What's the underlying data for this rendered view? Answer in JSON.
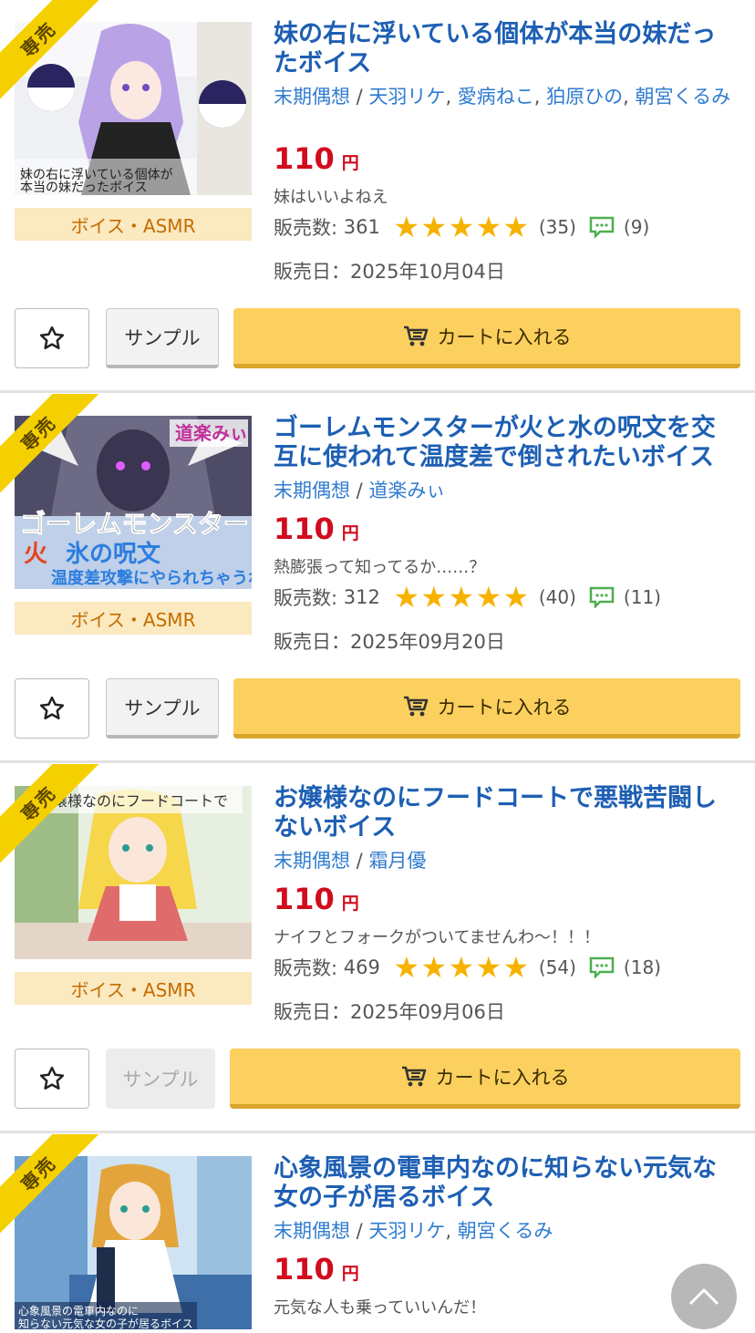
{
  "badge_label": "専売",
  "genre_label": "ボイス・ASMR",
  "currency": "円",
  "sales_label": "販売数:",
  "date_label": "販売日：",
  "sample_label": "サンプル",
  "cart_label": "カートに入れる",
  "colors": {
    "title": "#1d5fb3",
    "price": "#d20b1e",
    "star": "#f7b200",
    "cart": "#fcd05f",
    "badge": "#f5d000"
  },
  "products": [
    {
      "title": "妹の右に浮いている個体が本当の妹だったボイス",
      "circle": "末期偶想",
      "cast": [
        "天羽リケ",
        "愛病ねこ",
        "狛原ひの",
        "朝宮くるみ"
      ],
      "price": "110",
      "description": "妹はいいよねえ",
      "sales": "361",
      "rating": 5,
      "rating_count": "(35)",
      "review_count": "(9)",
      "release_date": "2025年10月04日",
      "sample_enabled": true
    },
    {
      "title": "ゴーレムモンスターが火と水の呪文を交互に使われて温度差で倒されたいボイス",
      "circle": "末期偶想",
      "cast": [
        "道楽みぃ"
      ],
      "price": "110",
      "description": "熱膨張って知ってるか……？",
      "sales": "312",
      "rating": 5,
      "rating_count": "(40)",
      "review_count": "(11)",
      "release_date": "2025年09月20日",
      "sample_enabled": true
    },
    {
      "title": "お嬢様なのにフードコートで悪戦苦闘しないボイス",
      "circle": "末期偶想",
      "cast": [
        "霜月優"
      ],
      "price": "110",
      "description": "ナイフとフォークがついてませんわ〜！！！",
      "sales": "469",
      "rating": 5,
      "rating_count": "(54)",
      "review_count": "(18)",
      "release_date": "2025年09月06日",
      "sample_enabled": false
    },
    {
      "title": "心象風景の電車内なのに知らない元気な女の子が居るボイス",
      "circle": "末期偶想",
      "cast": [
        "天羽リケ",
        "朝宮くるみ"
      ],
      "price": "110",
      "description": "元気な人も乗っていいんだ！"
    }
  ]
}
